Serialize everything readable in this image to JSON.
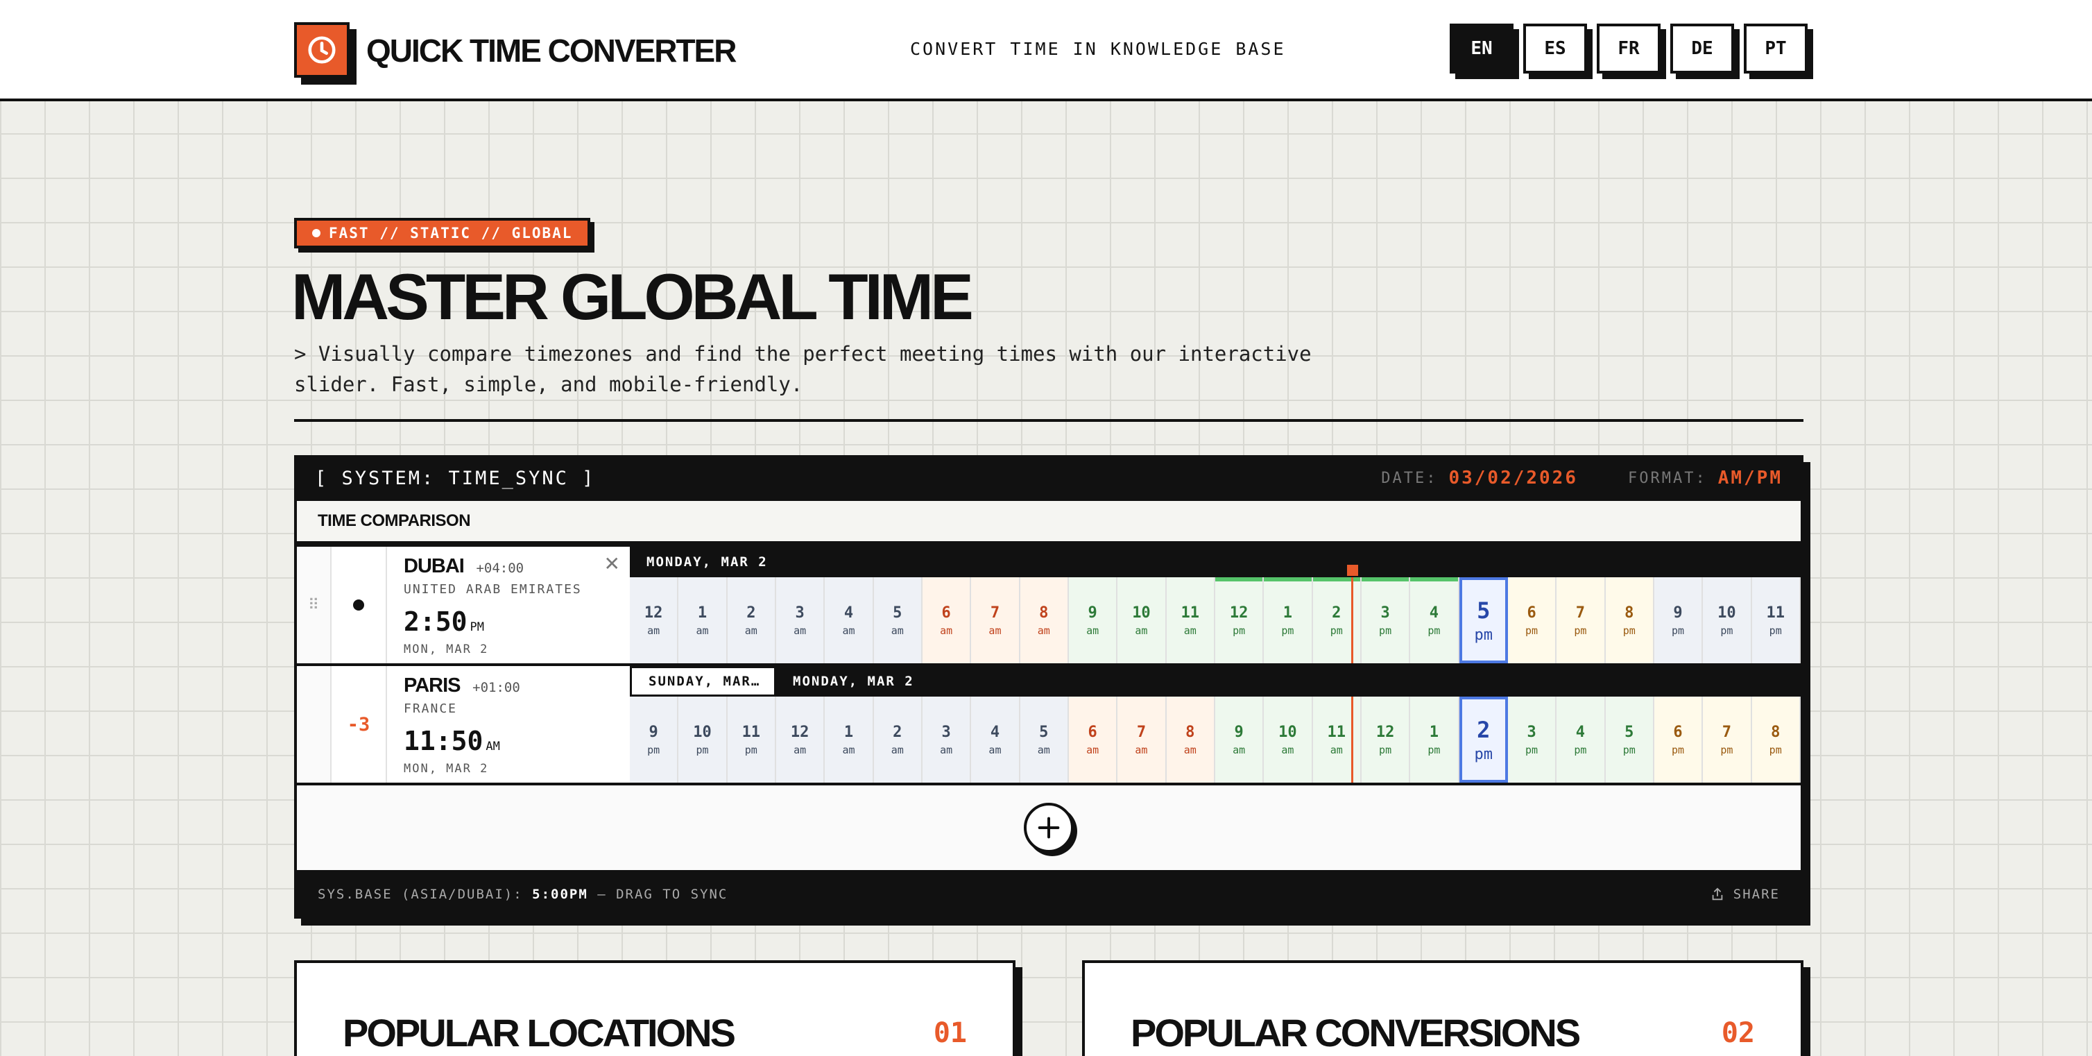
{
  "header": {
    "brand": "QUICK TIME CONVERTER",
    "nav_link": "CONVERT TIME IN KNOWLEDGE BASE",
    "languages": [
      "EN",
      "ES",
      "FR",
      "DE",
      "PT"
    ],
    "active_language": "EN"
  },
  "hero": {
    "badge": "FAST // STATIC // GLOBAL",
    "title": "MASTER GLOBAL TIME",
    "subtitle": "> Visually compare timezones and find the perfect meeting times with our interactive slider. Fast, simple, and mobile-friendly."
  },
  "system_bar": {
    "title": "[ SYSTEM: TIME_SYNC ]",
    "date_label": "DATE:",
    "date_value": "03/02/2026",
    "format_label": "FORMAT:",
    "format_value": "AM/PM"
  },
  "comparison": {
    "heading": "TIME COMPARISON",
    "rows": [
      {
        "city": "DUBAI",
        "utc": "+04:00",
        "country": "UNITED ARAB EMIRATES",
        "time": "2:50",
        "ampm": "PM",
        "date": "MON, MAR 2",
        "offset": "",
        "day_headers": [
          "MONDAY, MAR 2"
        ],
        "hours": [
          {
            "h": "12",
            "p": "am",
            "k": "night"
          },
          {
            "h": "1",
            "p": "am",
            "k": "night"
          },
          {
            "h": "2",
            "p": "am",
            "k": "night"
          },
          {
            "h": "3",
            "p": "am",
            "k": "night"
          },
          {
            "h": "4",
            "p": "am",
            "k": "night"
          },
          {
            "h": "5",
            "p": "am",
            "k": "night"
          },
          {
            "h": "6",
            "p": "am",
            "k": "morn"
          },
          {
            "h": "7",
            "p": "am",
            "k": "morn"
          },
          {
            "h": "8",
            "p": "am",
            "k": "morn"
          },
          {
            "h": "9",
            "p": "am",
            "k": "work"
          },
          {
            "h": "10",
            "p": "am",
            "k": "work"
          },
          {
            "h": "11",
            "p": "am",
            "k": "work"
          },
          {
            "h": "12",
            "p": "pm",
            "k": "work"
          },
          {
            "h": "1",
            "p": "pm",
            "k": "work"
          },
          {
            "h": "2",
            "p": "pm",
            "k": "work"
          },
          {
            "h": "3",
            "p": "pm",
            "k": "work"
          },
          {
            "h": "4",
            "p": "pm",
            "k": "work"
          },
          {
            "h": "5",
            "p": "pm",
            "k": "now"
          },
          {
            "h": "6",
            "p": "pm",
            "k": "even"
          },
          {
            "h": "7",
            "p": "pm",
            "k": "even"
          },
          {
            "h": "8",
            "p": "pm",
            "k": "even"
          },
          {
            "h": "9",
            "p": "pm",
            "k": "night"
          },
          {
            "h": "10",
            "p": "pm",
            "k": "night"
          },
          {
            "h": "11",
            "p": "pm",
            "k": "night"
          }
        ]
      },
      {
        "city": "PARIS",
        "utc": "+01:00",
        "country": "FRANCE",
        "time": "11:50",
        "ampm": "AM",
        "date": "MON, MAR 2",
        "offset": "-3",
        "day_headers": [
          "SUNDAY, MAR…",
          "MONDAY, MAR 2"
        ],
        "hours": [
          {
            "h": "9",
            "p": "pm",
            "k": "night"
          },
          {
            "h": "10",
            "p": "pm",
            "k": "night"
          },
          {
            "h": "11",
            "p": "pm",
            "k": "night"
          },
          {
            "h": "12",
            "p": "am",
            "k": "night"
          },
          {
            "h": "1",
            "p": "am",
            "k": "night"
          },
          {
            "h": "2",
            "p": "am",
            "k": "night"
          },
          {
            "h": "3",
            "p": "am",
            "k": "night"
          },
          {
            "h": "4",
            "p": "am",
            "k": "night"
          },
          {
            "h": "5",
            "p": "am",
            "k": "night"
          },
          {
            "h": "6",
            "p": "am",
            "k": "morn"
          },
          {
            "h": "7",
            "p": "am",
            "k": "morn"
          },
          {
            "h": "8",
            "p": "am",
            "k": "morn"
          },
          {
            "h": "9",
            "p": "am",
            "k": "work"
          },
          {
            "h": "10",
            "p": "am",
            "k": "work"
          },
          {
            "h": "11",
            "p": "am",
            "k": "work"
          },
          {
            "h": "12",
            "p": "pm",
            "k": "work"
          },
          {
            "h": "1",
            "p": "pm",
            "k": "work"
          },
          {
            "h": "2",
            "p": "pm",
            "k": "now"
          },
          {
            "h": "3",
            "p": "pm",
            "k": "work"
          },
          {
            "h": "4",
            "p": "pm",
            "k": "work"
          },
          {
            "h": "5",
            "p": "pm",
            "k": "work"
          },
          {
            "h": "6",
            "p": "pm",
            "k": "even"
          },
          {
            "h": "7",
            "p": "pm",
            "k": "even"
          },
          {
            "h": "8",
            "p": "pm",
            "k": "even"
          }
        ]
      }
    ]
  },
  "footer_bar": {
    "base_label": "SYS.BASE (ASIA/DUBAI):",
    "base_time": "5:00PM",
    "hint": "— DRAG TO SYNC",
    "share": "SHARE"
  },
  "panels": [
    {
      "title": "POPULAR LOCATIONS",
      "num": "01"
    },
    {
      "title": "POPULAR CONVERSIONS",
      "num": "02"
    }
  ],
  "colors": {
    "accent": "#e85a2a",
    "ink": "#111111",
    "now_highlight": "#4d79e3",
    "working_band": "#56c46a"
  }
}
